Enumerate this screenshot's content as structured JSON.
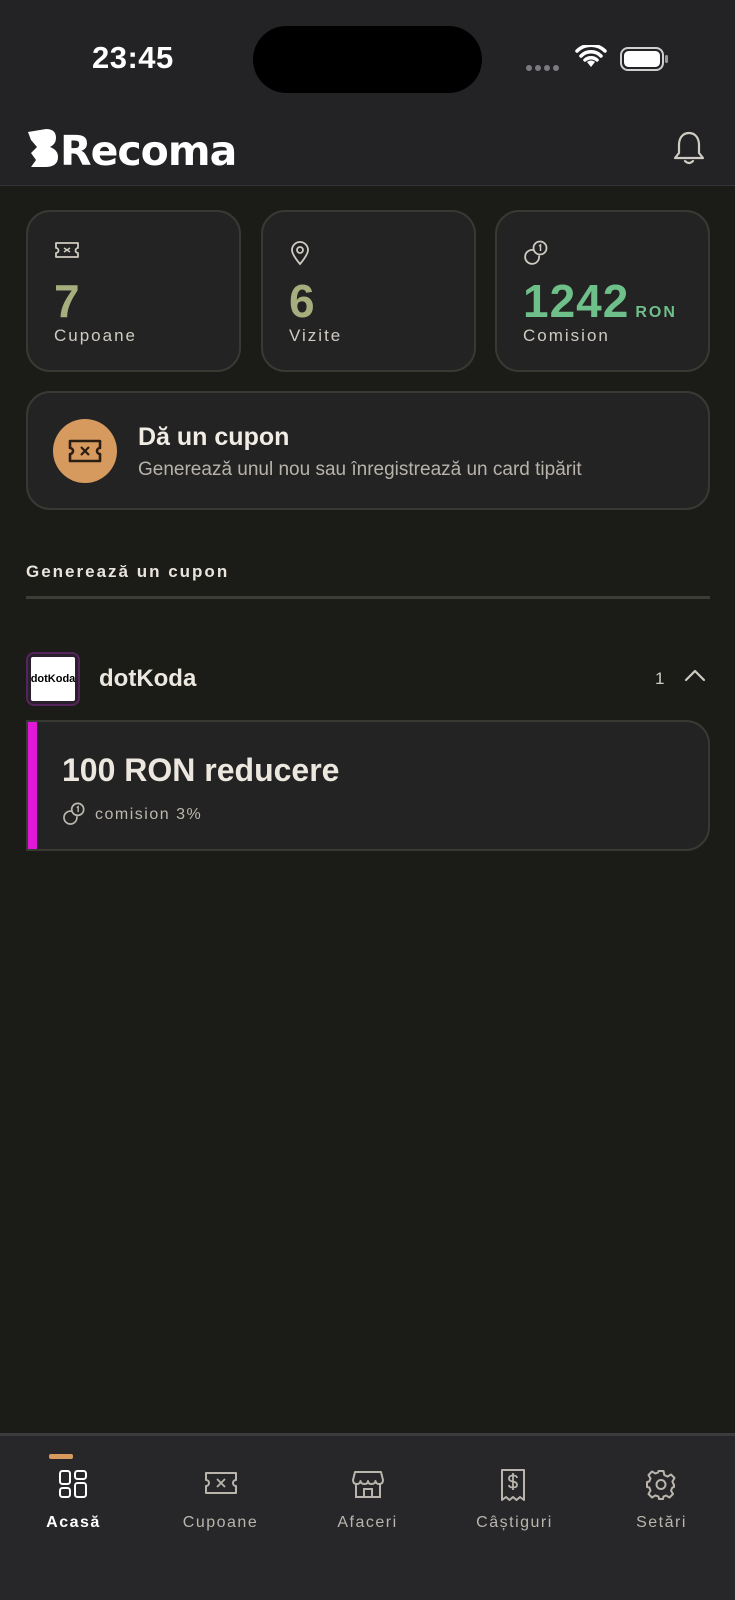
{
  "status_bar": {
    "time": "23:45"
  },
  "header": {
    "app_name": "Recoma"
  },
  "stats": [
    {
      "icon": "ticket-icon",
      "value": "7",
      "unit": "",
      "label": "Cupoane"
    },
    {
      "icon": "map-pin-icon",
      "value": "6",
      "unit": "",
      "label": "Vizite"
    },
    {
      "icon": "coins-icon",
      "value": "1242",
      "unit": "RON",
      "label": "Comision"
    }
  ],
  "give_coupon": {
    "title": "Dă un cupon",
    "subtitle": "Generează unul nou sau înregistrează un card tipărit"
  },
  "section": {
    "title": "Generează un cupon"
  },
  "business": {
    "name": "dotKoda",
    "logo_text": "dotKoda",
    "count": "1",
    "coupon": {
      "title": "100 RON reducere",
      "commission": "comision 3%"
    }
  },
  "tabs": [
    {
      "label": "Acasă",
      "icon": "grid-icon",
      "active": true
    },
    {
      "label": "Cupoane",
      "icon": "ticket-icon",
      "active": false
    },
    {
      "label": "Afaceri",
      "icon": "store-icon",
      "active": false
    },
    {
      "label": "Câștiguri",
      "icon": "receipt-icon",
      "active": false
    },
    {
      "label": "Setări",
      "icon": "gear-icon",
      "active": false
    }
  ],
  "colors": {
    "accent": "#d69a5f",
    "stat_value": "#a7ae7e",
    "commission": "#6fbf8a",
    "coupon_accent": "#e218d8",
    "background": "#1b1b18"
  }
}
